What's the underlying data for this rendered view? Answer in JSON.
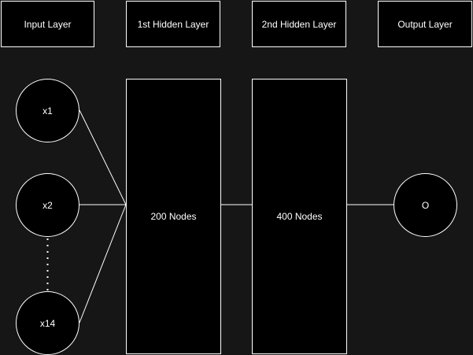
{
  "headers": {
    "input": "Input Layer",
    "hidden1": "1st Hidden Layer",
    "hidden2": "2nd Hidden Layer",
    "output": "Output Layer"
  },
  "layers": {
    "hidden1": "200 Nodes",
    "hidden2": "400 Nodes"
  },
  "input_nodes": [
    "x1",
    "x2",
    "x14"
  ],
  "output_node": "O",
  "colors": {
    "background": "#161616",
    "shape_fill": "#000000",
    "stroke": "#ffffff",
    "text": "#ffffff"
  }
}
